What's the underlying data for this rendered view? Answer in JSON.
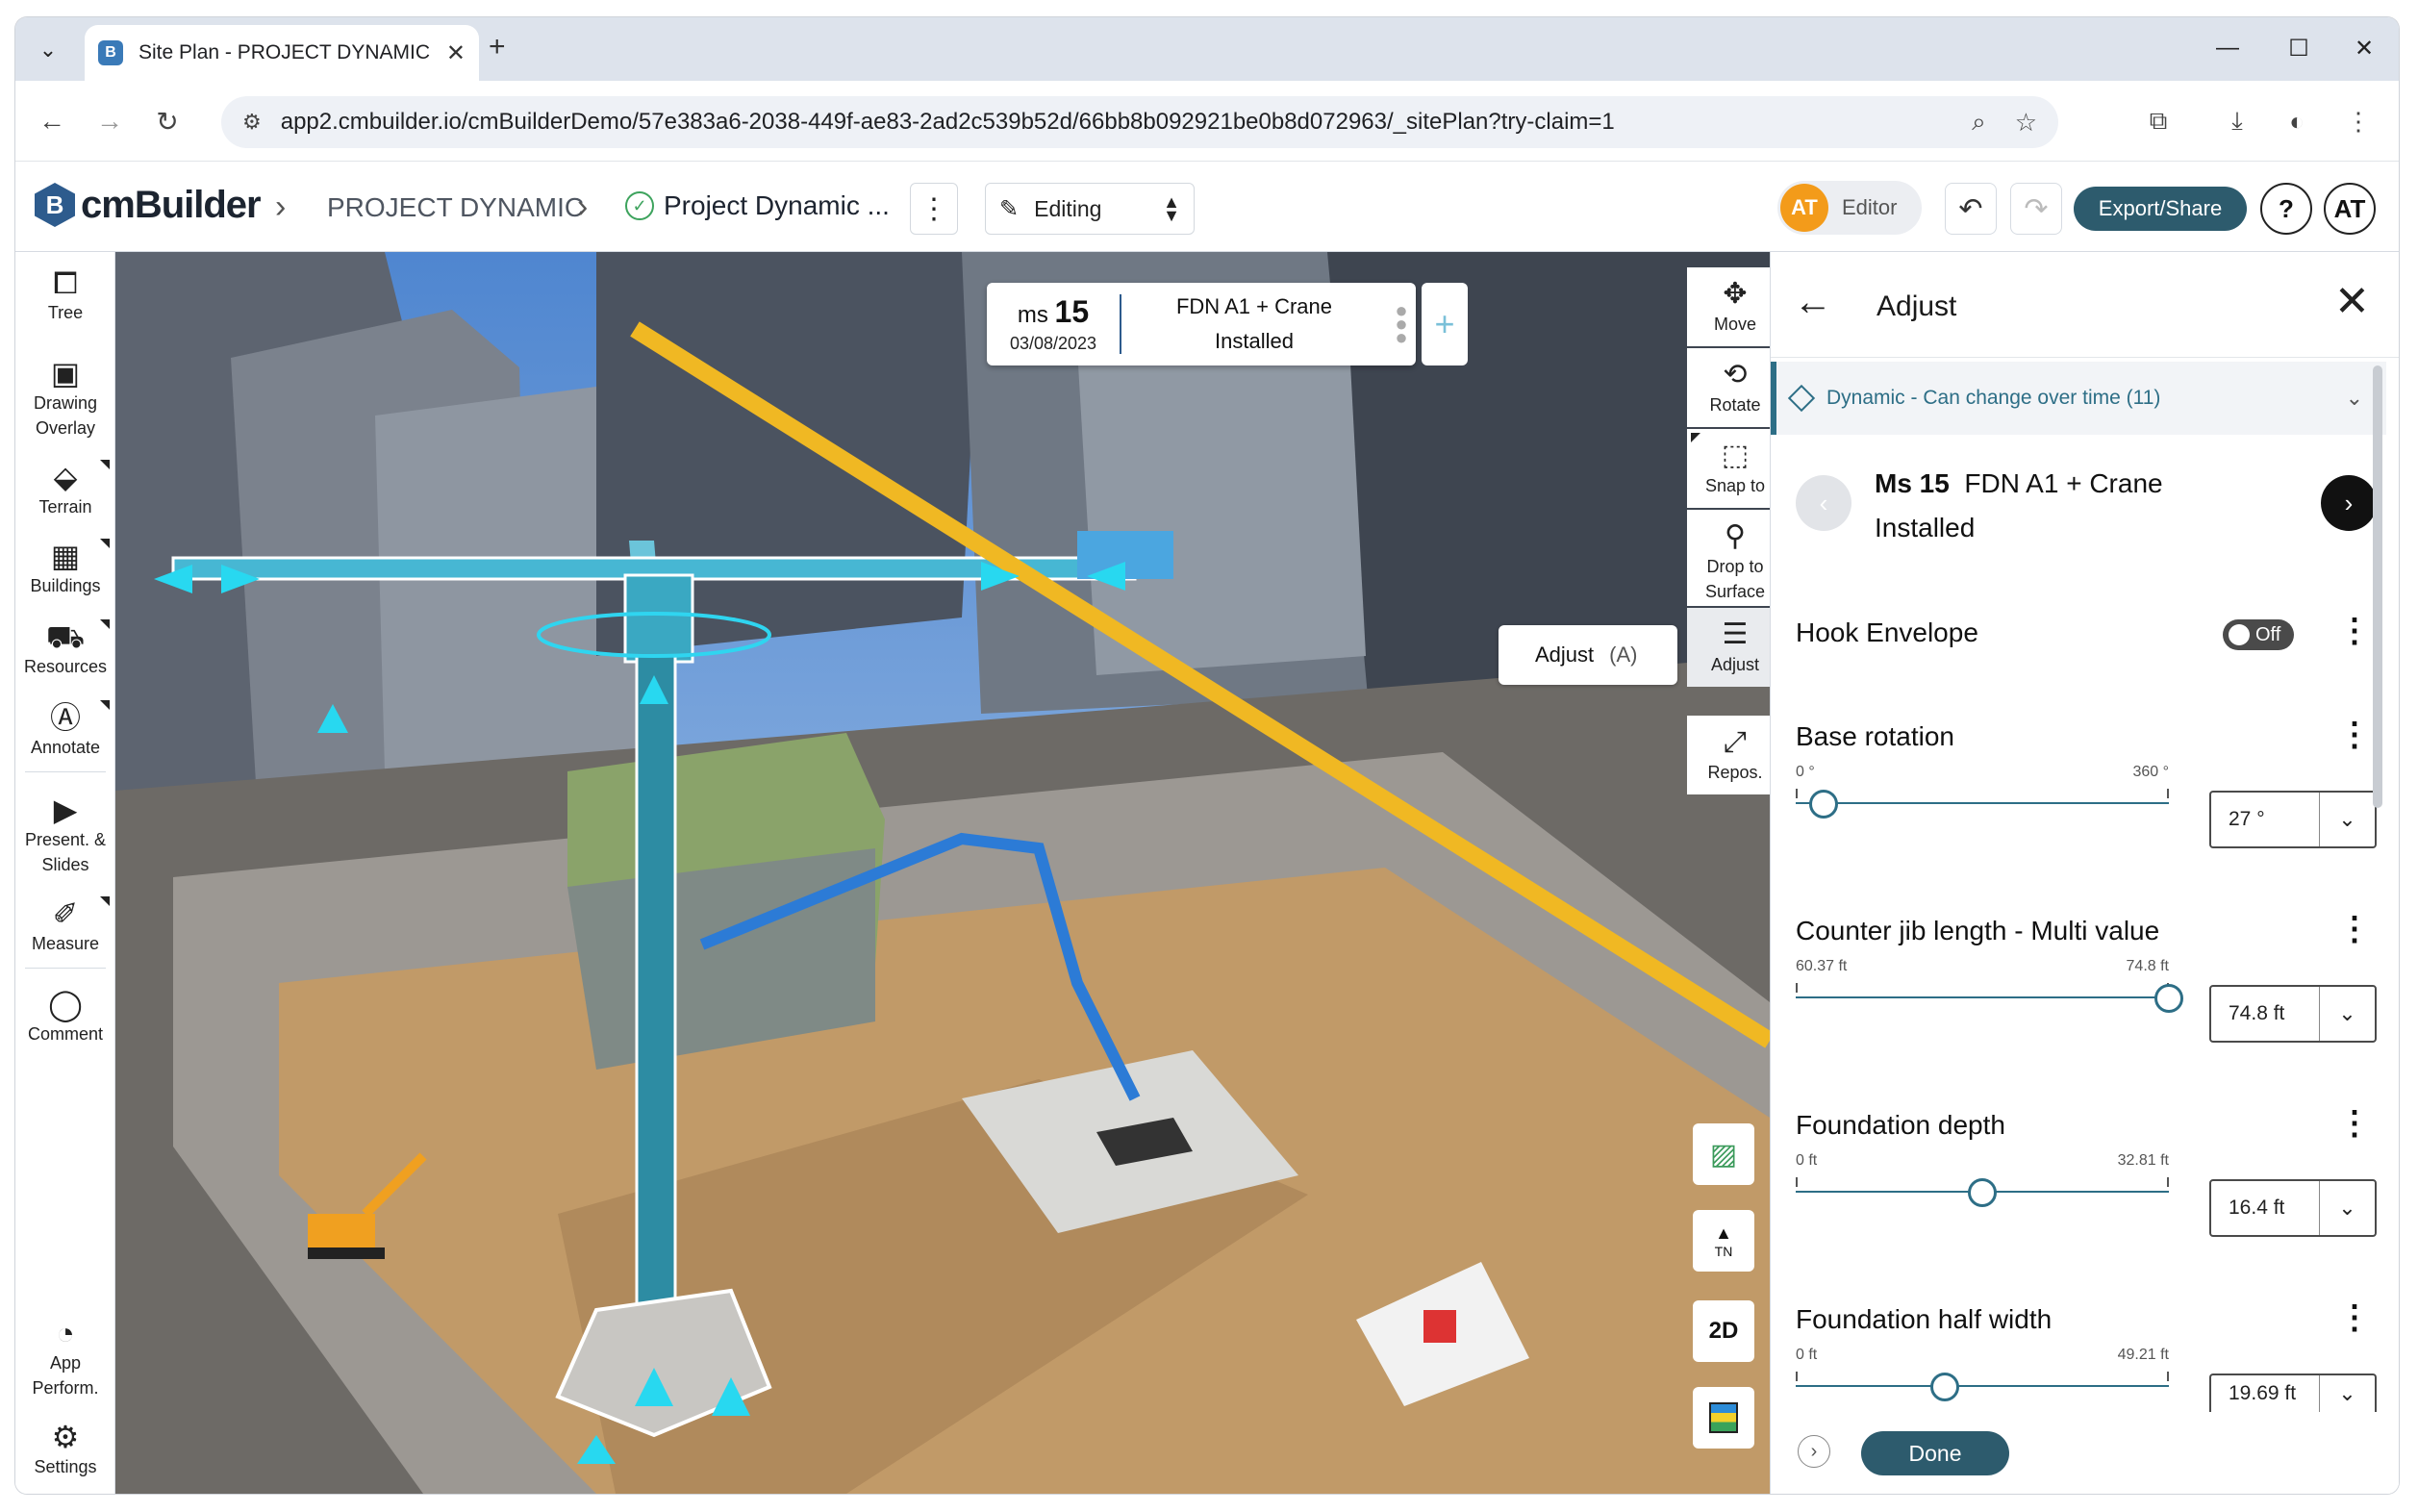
{
  "browser": {
    "tab_title": "Site Plan - PROJECT DYNAMIC |",
    "favicon_letter": "B",
    "url": "app2.cmbuilder.io/cmBuilderDemo/57e383a6-2038-449f-ae83-2ad2c539b52d/66bb8b092921be0b8d072963/_sitePlan?try-claim=1"
  },
  "header": {
    "logo_text": "cmBuilder",
    "logo_mark": "B",
    "project_name": "PROJECT DYNAMIC",
    "plan_name": "Project Dynamic ...",
    "mode": "Editing",
    "user_initials": "AT",
    "role": "Editor",
    "export_label": "Export/Share",
    "help_label": "?",
    "profile_initials": "AT"
  },
  "left_tools": [
    {
      "label": "Tree"
    },
    {
      "label": "Drawing Overlay"
    },
    {
      "label": "Terrain"
    },
    {
      "label": "Buildings"
    },
    {
      "label": "Resources"
    },
    {
      "label": "Annotate"
    },
    {
      "label": "Present. & Slides"
    },
    {
      "label": "Measure"
    },
    {
      "label": "Comment"
    },
    {
      "label": "App Perform."
    },
    {
      "label": "Settings"
    }
  ],
  "milestone_card": {
    "prefix": "ms",
    "number": "15",
    "date": "03/08/2023",
    "line1": "FDN A1 + Crane",
    "line2": "Installed"
  },
  "tools3d": [
    {
      "label": "Move"
    },
    {
      "label": "Rotate"
    },
    {
      "label": "Snap to"
    },
    {
      "label": "Drop to Surface"
    },
    {
      "label": "Adjust"
    },
    {
      "label": "Repos."
    }
  ],
  "adjust_tooltip": {
    "label": "Adjust",
    "shortcut": "(A)"
  },
  "view_controls": {
    "north_label": "TN",
    "view_mode": "2D"
  },
  "panel": {
    "title": "Adjust",
    "dynamic_label": "Dynamic - Can change over time (11)",
    "milestone_prefix": "Ms 15",
    "milestone_name": "FDN A1 + Crane",
    "milestone_status": "Installed",
    "hook_envelope": {
      "title": "Hook Envelope",
      "state": "Off"
    },
    "properties": [
      {
        "title": "Base rotation",
        "min": "0 °",
        "max": "360 °",
        "value": "27 °",
        "fraction": 0.075
      },
      {
        "title": "Counter jib length - Multi value",
        "min": "60.37 ft",
        "max": "74.8 ft",
        "value": "74.8 ft",
        "fraction": 1.0
      },
      {
        "title": "Foundation depth",
        "min": "0 ft",
        "max": "32.81 ft",
        "value": "16.4 ft",
        "fraction": 0.5
      },
      {
        "title": "Foundation half width",
        "min": "0 ft",
        "max": "49.21 ft",
        "value": "19.69 ft",
        "fraction": 0.4
      }
    ],
    "done_label": "Done"
  }
}
